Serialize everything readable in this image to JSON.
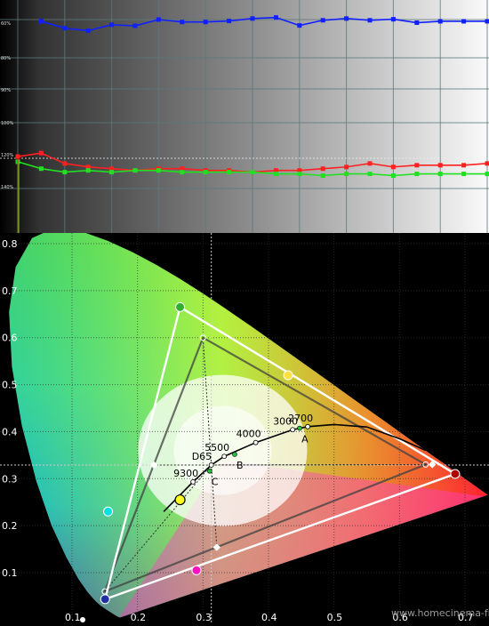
{
  "chart_data": [
    {
      "type": "line",
      "x": [
        0,
        5,
        10,
        15,
        20,
        25,
        30,
        35,
        40,
        45,
        50,
        55,
        60,
        65,
        70,
        75,
        80,
        85,
        90,
        95,
        100
      ],
      "ylim": [
        0,
        140
      ],
      "y_tick_labels": [
        "60%",
        "80%",
        "90%",
        "100%",
        "120%",
        "140%"
      ],
      "reference_line": 100,
      "background": "gray ramp black to white",
      "series": [
        {
          "color": "#1020ff",
          "values": [
            null,
            139.5,
            137.5,
            136.8,
            138.5,
            138.2,
            140,
            139.3,
            139.3,
            139.6,
            140.3,
            140.6,
            138.3,
            139.8,
            140.3,
            139.8,
            140.1,
            139.1,
            139.5,
            139.5,
            139.5
          ]
        },
        {
          "color": "#ff2020",
          "values": [
            100.5,
            101.5,
            98.5,
            97.5,
            97,
            96.5,
            97,
            97,
            96.5,
            96.5,
            96,
            96.5,
            96.5,
            97,
            97.5,
            98.5,
            97.5,
            98,
            98,
            98,
            98.5
          ]
        },
        {
          "color": "#20e020",
          "values": [
            99,
            97,
            96,
            96.5,
            96,
            96.5,
            96.5,
            96,
            96,
            96,
            96,
            95.5,
            95.5,
            95,
            95.5,
            95.5,
            95,
            95.5,
            95.5,
            95.5,
            95.5
          ]
        }
      ]
    },
    {
      "type": "scatter",
      "xlim": [
        0.0,
        0.7
      ],
      "ylim": [
        0.0,
        0.8
      ],
      "x_tick_labels": [
        "0.1",
        "0.2",
        "0.3",
        "0.4",
        "0.5",
        "0.6",
        "0.7"
      ],
      "y_tick_labels": [
        "0.1",
        "0.2",
        "0.3",
        "0.4",
        "0.5",
        "0.6",
        "0.7",
        "0.8"
      ],
      "grid": true,
      "reference_gamut": [
        [
          0.64,
          0.33
        ],
        [
          0.3,
          0.6
        ],
        [
          0.15,
          0.06
        ]
      ],
      "measured_gamut": [
        [
          0.685,
          0.31
        ],
        [
          0.265,
          0.665
        ],
        [
          0.1505,
          0.0435
        ]
      ],
      "white_point": [
        0.3127,
        0.329
      ],
      "measured_white": [
        0.265,
        0.255
      ],
      "planckian_labels": [
        {
          "label": "9300",
          "x": 0.2848,
          "y": 0.2932
        },
        {
          "label": "D65",
          "x": 0.3127,
          "y": 0.329
        },
        {
          "label": "5500",
          "x": 0.3324,
          "y": 0.3474
        },
        {
          "label": "4000",
          "x": 0.3805,
          "y": 0.3768
        },
        {
          "label": "3000",
          "x": 0.4369,
          "y": 0.4041
        },
        {
          "label": "2700",
          "x": 0.4599,
          "y": 0.4106
        }
      ],
      "illuminants": [
        {
          "label": "A",
          "x": 0.4476,
          "y": 0.4074
        },
        {
          "label": "B",
          "x": 0.3484,
          "y": 0.3516
        },
        {
          "label": "C",
          "x": 0.3101,
          "y": 0.3162
        }
      ],
      "secondary_markers": [
        {
          "x": 0.43,
          "y": 0.52,
          "color": "#ffe040"
        },
        {
          "x": 0.155,
          "y": 0.23,
          "color": "#00e0e0"
        },
        {
          "x": 0.29,
          "y": 0.105,
          "color": "#ff10c0"
        }
      ],
      "reference_secondaries": [
        {
          "x": 0.225,
          "y": 0.329
        },
        {
          "x": 0.321,
          "y": 0.154
        },
        {
          "x": 0.65,
          "y": 0.33
        }
      ]
    }
  ],
  "watermark": "www.homecinema-fr.com"
}
